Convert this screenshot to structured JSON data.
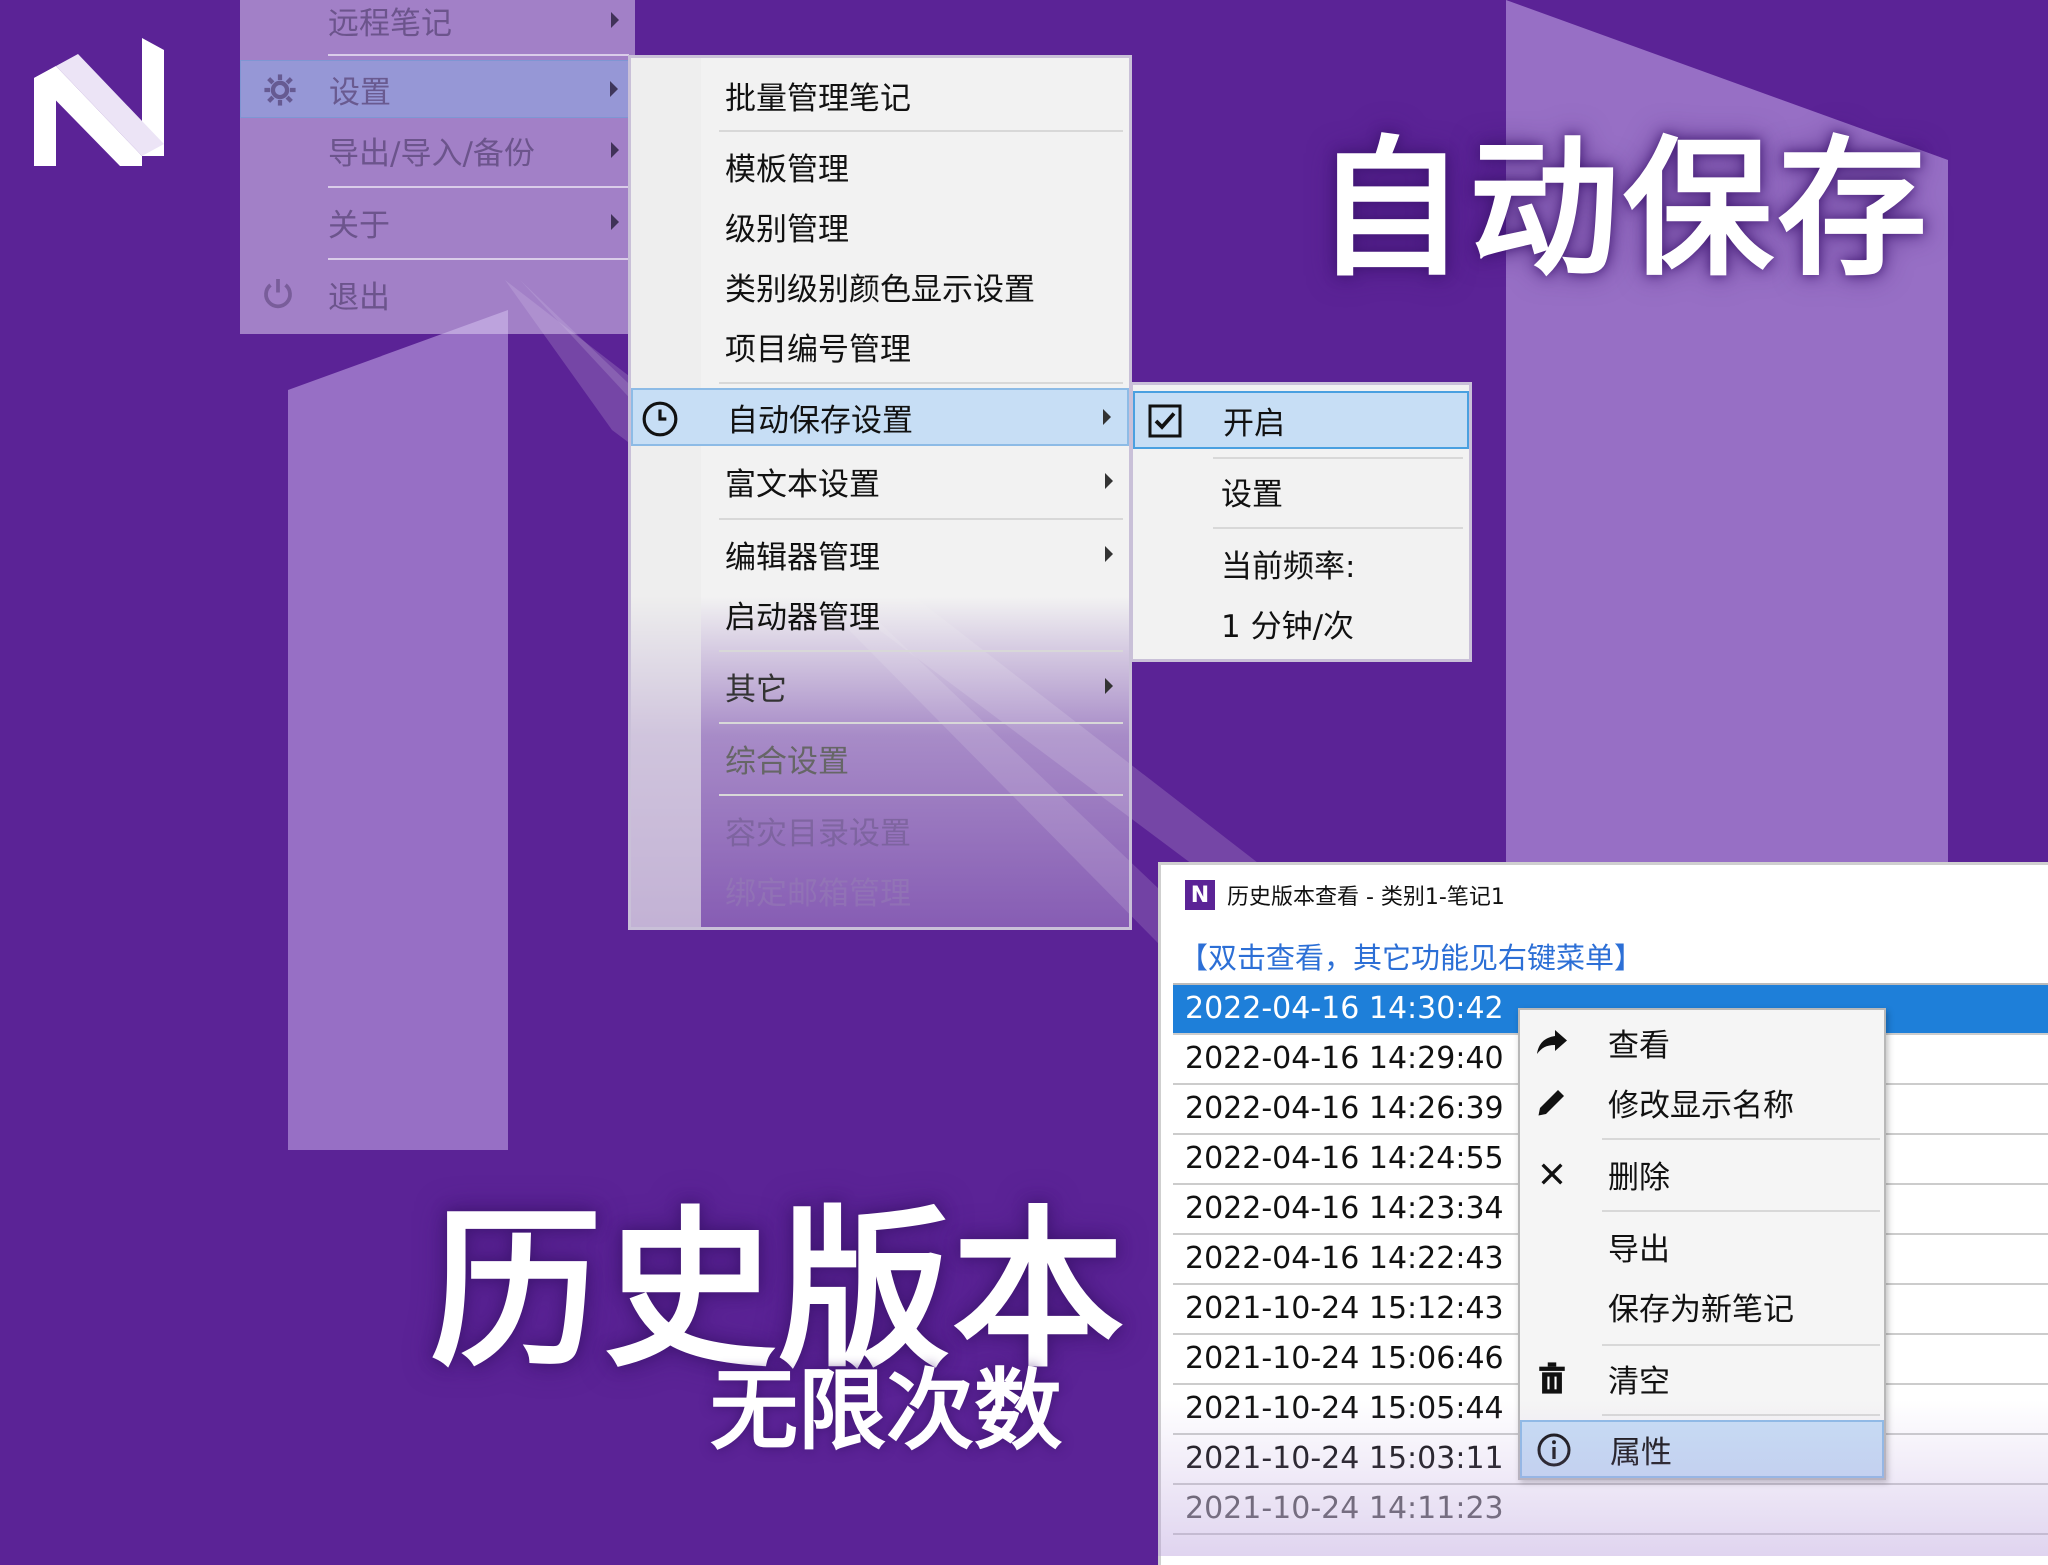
{
  "titles": {
    "autosave": "自动保存",
    "history": "历史版本",
    "history_sub": "无限次数"
  },
  "root_menu": {
    "items": [
      {
        "label": "远程笔记"
      },
      {
        "label": "设置"
      },
      {
        "label": "导出/导入/备份"
      },
      {
        "label": "关于"
      },
      {
        "label": "退出"
      }
    ]
  },
  "settings_menu": {
    "items": [
      {
        "label": "批量管理笔记"
      },
      {
        "label": "模板管理"
      },
      {
        "label": "级别管理"
      },
      {
        "label": "类别级别颜色显示设置"
      },
      {
        "label": "项目编号管理"
      },
      {
        "label": "自动保存设置"
      },
      {
        "label": "富文本设置"
      },
      {
        "label": "编辑器管理"
      },
      {
        "label": "启动器管理"
      },
      {
        "label": "其它"
      },
      {
        "label": "综合设置"
      },
      {
        "label": "容灾目录设置"
      },
      {
        "label": "绑定邮箱管理"
      }
    ]
  },
  "autosave_menu": {
    "items": [
      {
        "label": "开启",
        "checked": true
      },
      {
        "label": "设置"
      },
      {
        "label": "当前频率:"
      },
      {
        "label": "1 分钟/次"
      }
    ]
  },
  "history_window": {
    "title": "历史版本查看 - 类别1-笔记1",
    "icon_letter": "N",
    "hint": "【双击查看，其它功能见右键菜单】",
    "rows": [
      "2022-04-16 14:30:42",
      "2022-04-16 14:29:40",
      "2022-04-16 14:26:39",
      "2022-04-16 14:24:55",
      "2022-04-16 14:23:34",
      "2022-04-16 14:22:43",
      "2021-10-24 15:12:43",
      "2021-10-24 15:06:46",
      "2021-10-24 15:05:44",
      "2021-10-24 15:03:11",
      "2021-10-24 14:11:23"
    ]
  },
  "context_menu": {
    "items": [
      {
        "label": "查看",
        "icon": "share-arrow-icon"
      },
      {
        "label": "修改显示名称",
        "icon": "pencil-icon"
      },
      {
        "label": "删除",
        "icon": "close-icon"
      },
      {
        "label": "导出",
        "icon": ""
      },
      {
        "label": "保存为新笔记",
        "icon": ""
      },
      {
        "label": "清空",
        "icon": "trash-icon"
      },
      {
        "label": "属性",
        "icon": "info-icon"
      }
    ]
  },
  "colors": {
    "background": "#5b2396",
    "accent_shape": "#9b74c7",
    "selection": "#1e7fd9",
    "menu_highlight": "#c7def5",
    "hint_text": "#2c6fd6"
  }
}
